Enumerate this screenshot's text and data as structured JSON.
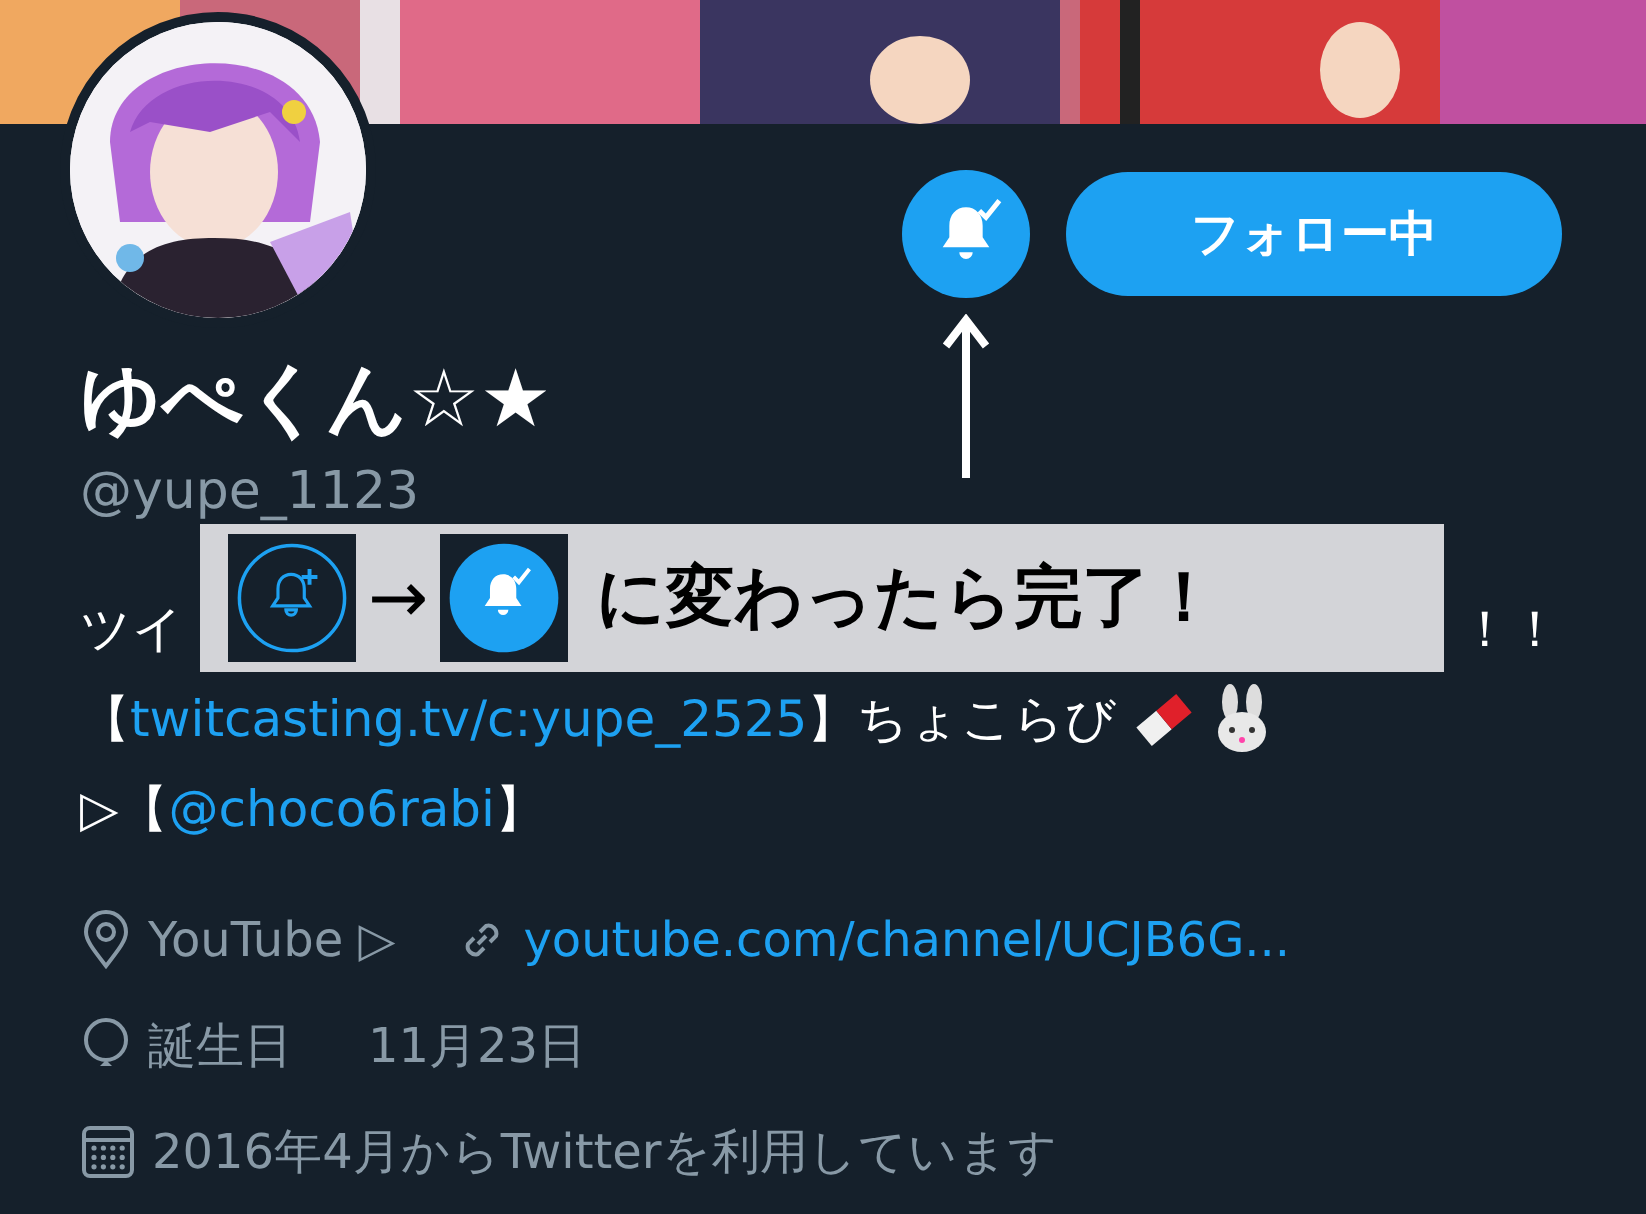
{
  "banner": {
    "kind": "picture"
  },
  "avatar": {
    "kind": "picture"
  },
  "follow_button": {
    "label": "フォロー中"
  },
  "profile": {
    "name": "ゆぺくん☆★",
    "handle": "@yupe_1123"
  },
  "bio_lines": [
    [
      {
        "kind": "text",
        "text": "ツイ"
      },
      {
        "kind": "text",
        "text": "！！"
      }
    ],
    [
      {
        "kind": "text",
        "text": "【"
      },
      {
        "kind": "link",
        "text": "twitcasting.tv/c:yupe_2525"
      },
      {
        "kind": "text",
        "text": "】ちょこらび"
      },
      {
        "kind": "eraser"
      },
      {
        "kind": "rabbit"
      }
    ],
    [
      {
        "kind": "text",
        "text": "▷【"
      },
      {
        "kind": "link",
        "text": "@choco6rabi"
      },
      {
        "kind": "text",
        "text": "】"
      }
    ]
  ],
  "meta": [
    [
      {
        "kind": "location",
        "text": "YouTube ▷"
      },
      {
        "kind": "link",
        "text": "youtube.com/channel/UCJB6G..."
      }
    ],
    [
      {
        "kind": "birthday",
        "text": "誕生日"
      },
      {
        "kind": "plain",
        "text": "11月23日"
      }
    ],
    [
      {
        "kind": "joined",
        "text": "2016年4月からTwitterを利用しています"
      }
    ]
  ],
  "annotation": {
    "arrow": "→",
    "text": "に変わったら完了！"
  }
}
